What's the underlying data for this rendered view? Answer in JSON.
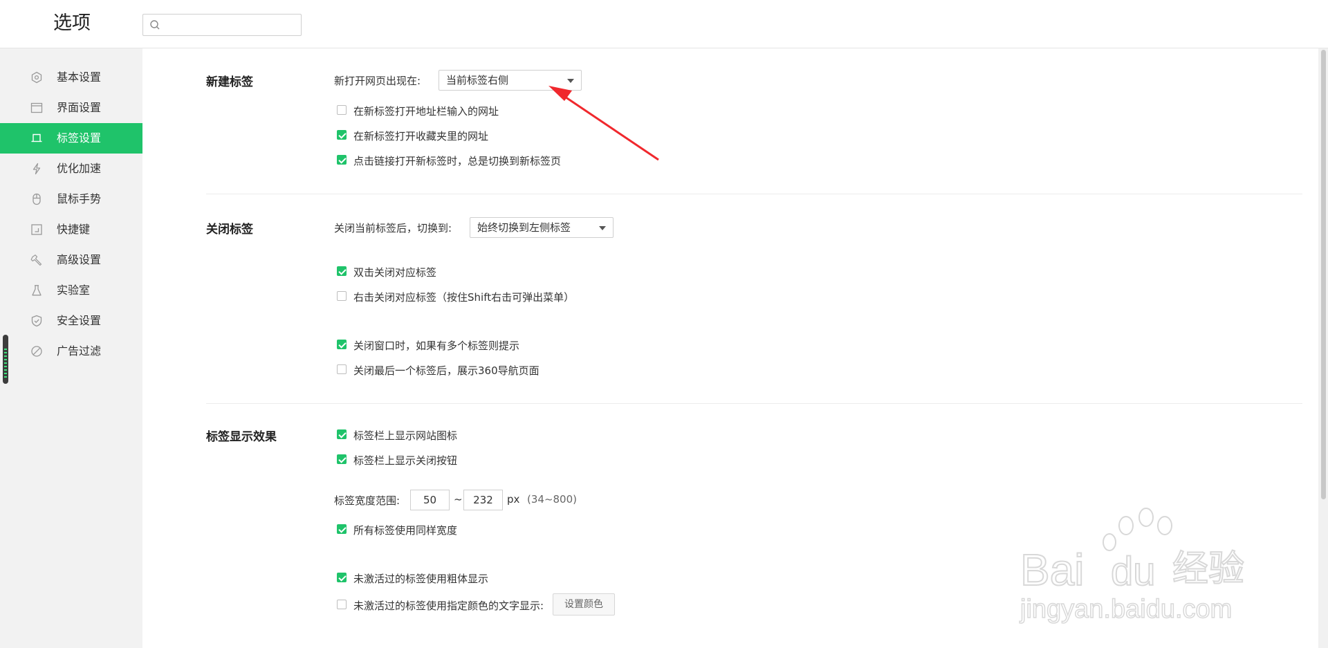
{
  "window": {
    "title": "选项"
  },
  "search": {
    "placeholder": ""
  },
  "sidebar": {
    "items": [
      {
        "label": "基本设置",
        "icon": "gear-icon"
      },
      {
        "label": "界面设置",
        "icon": "window-icon"
      },
      {
        "label": "标签设置",
        "icon": "tab-icon",
        "active": true
      },
      {
        "label": "优化加速",
        "icon": "lightning-icon"
      },
      {
        "label": "鼠标手势",
        "icon": "mouse-icon"
      },
      {
        "label": "快捷键",
        "icon": "keyboard-shortcut-icon"
      },
      {
        "label": "高级设置",
        "icon": "wrench-icon"
      },
      {
        "label": "实验室",
        "icon": "flask-icon"
      },
      {
        "label": "安全设置",
        "icon": "shield-icon"
      },
      {
        "label": "广告过滤",
        "icon": "block-icon"
      }
    ]
  },
  "new_tab": {
    "title": "新建标签",
    "open_position_label": "新打开网页出现在:",
    "open_position_value": "当前标签右侧",
    "options": [
      {
        "label": "在新标签打开地址栏输入的网址",
        "checked": false
      },
      {
        "label": "在新标签打开收藏夹里的网址",
        "checked": true
      },
      {
        "label": "点击链接打开新标签时，总是切换到新标签页",
        "checked": true
      }
    ]
  },
  "close_tab": {
    "title": "关闭标签",
    "switch_label": "关闭当前标签后，切换到:",
    "switch_value": "始终切换到左侧标签",
    "options": [
      {
        "label": "双击关闭对应标签",
        "checked": true
      },
      {
        "label": "右击关闭对应标签（按住Shift右击可弹出菜单）",
        "checked": false
      },
      {
        "label": "关闭窗口时，如果有多个标签则提示",
        "checked": true
      },
      {
        "label": "关闭最后一个标签后，展示360导航页面",
        "checked": false
      }
    ]
  },
  "tab_display": {
    "title": "标签显示效果",
    "options_top": [
      {
        "label": "标签栏上显示网站图标",
        "checked": true
      },
      {
        "label": "标签栏上显示关闭按钮",
        "checked": true
      }
    ],
    "width_label": "标签宽度范围:",
    "width_min": "50",
    "width_sep": "~",
    "width_max": "232",
    "width_unit": "px",
    "width_hint": "(34~800)",
    "same_width": {
      "label": "所有标签使用同样宽度",
      "checked": true
    },
    "bold_inactive": {
      "label": "未激活过的标签使用粗体显示",
      "checked": true
    },
    "color_inactive": {
      "label": "未激活过的标签使用指定颜色的文字显示:",
      "checked": false
    },
    "set_color_button": "设置颜色"
  },
  "watermark": {
    "brand": "Bai",
    "brand2": "du",
    "cn": "经验",
    "url": "jingyan.baidu.com"
  },
  "colors": {
    "accent": "#1fc36a",
    "annotation_arrow": "#f0282d"
  }
}
